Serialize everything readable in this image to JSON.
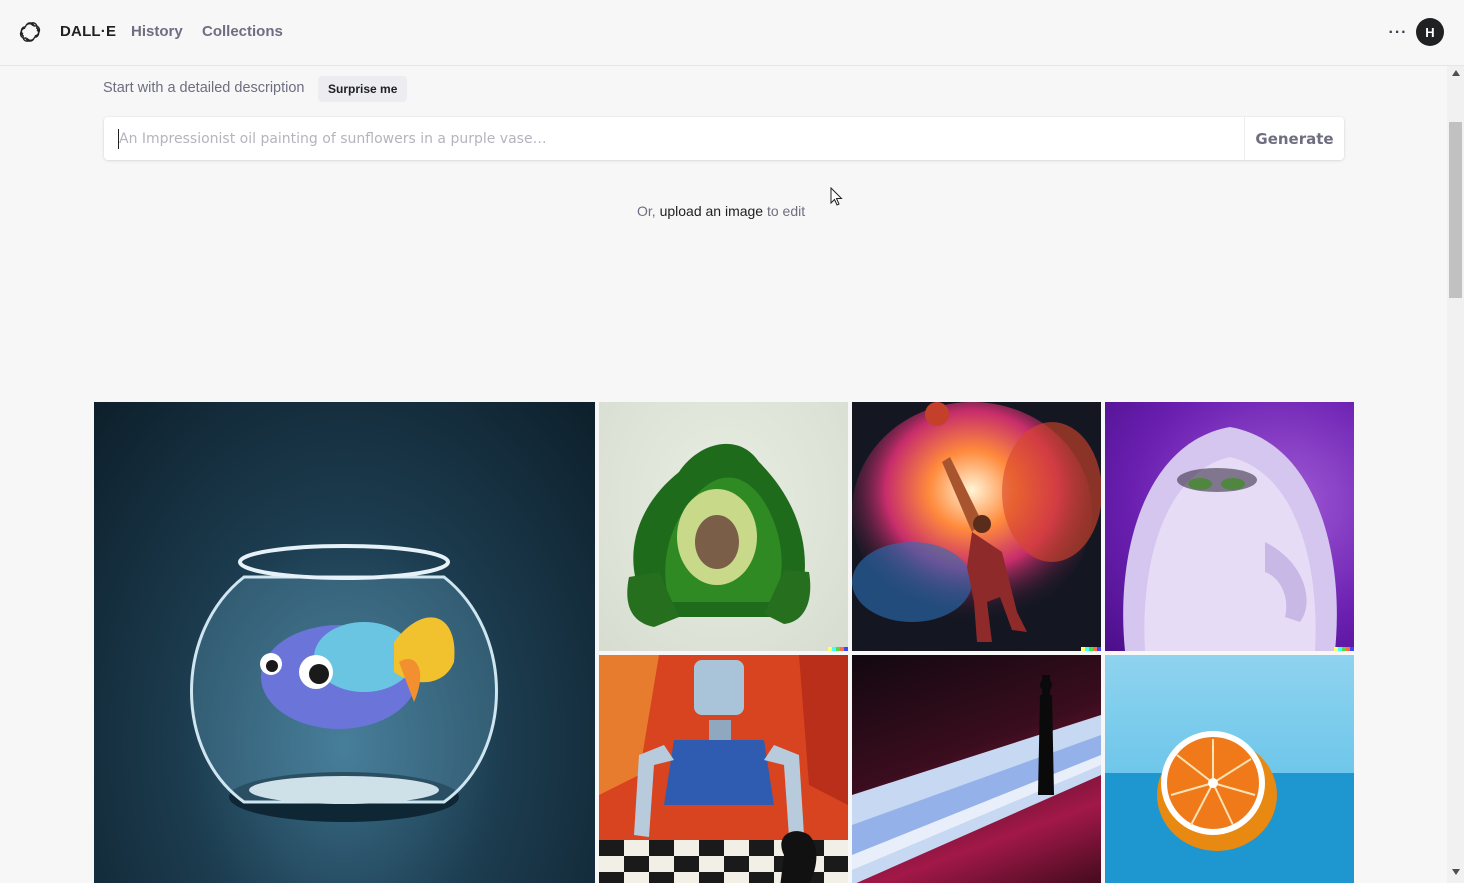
{
  "header": {
    "brand": "DALL·E",
    "nav": {
      "history": "History",
      "collections": "Collections"
    },
    "more_label": "···",
    "avatar_initial": "H"
  },
  "prompt": {
    "label": "Start with a detailed description",
    "surprise_label": "Surprise me",
    "placeholder": "An Impressionist oil painting of sunflowers in a purple vase…",
    "value": "",
    "generate_label": "Generate"
  },
  "upload": {
    "prefix": "Or,",
    "link": "upload an image",
    "suffix": "to edit"
  },
  "gallery": {
    "items": [
      {
        "subject": "3D fish in a glass fishbowl"
      },
      {
        "subject": "avocado-shaped green armchair"
      },
      {
        "subject": "basketball player dunking in a nebula painting"
      },
      {
        "subject": "fluffy purple monster with green eyes"
      },
      {
        "subject": "robot playing chess painting"
      },
      {
        "subject": "silhouette figure in a neon desert landscape"
      },
      {
        "subject": "halved orange on blue background"
      }
    ]
  },
  "colors": {
    "background": "#f7f7f8",
    "text_primary": "#202123",
    "text_secondary": "#6e6e80",
    "surprise_bg": "#ececf1",
    "avatar_bg": "#202123"
  }
}
